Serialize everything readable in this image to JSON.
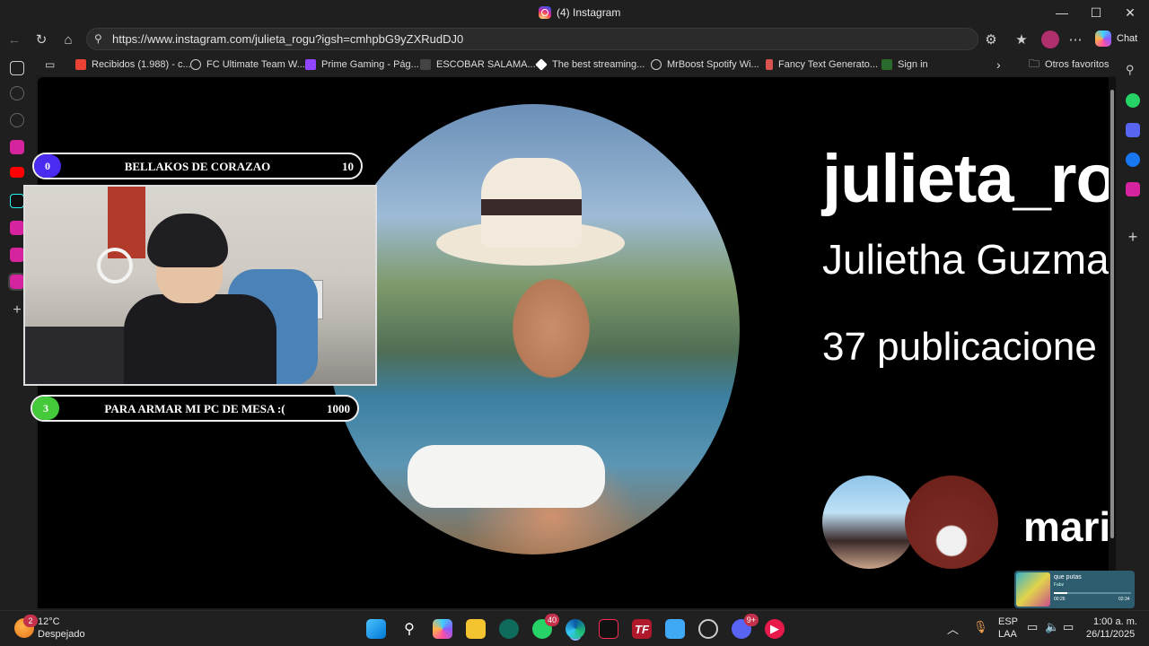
{
  "window": {
    "title": "(4) Instagram",
    "controls": {
      "minimize": "—",
      "maximize": "☐",
      "close": "✕"
    }
  },
  "nav": {
    "url": "https://www.instagram.com/julieta_rogu?igsh=cmhpbG9yZXRudDJ0",
    "chat_label": "Chat"
  },
  "bookmarks": [
    {
      "label": "Recibidos (1.988) - c...",
      "icon": "gmail-icon",
      "color": "#ea4335"
    },
    {
      "label": "FC Ultimate Team W...",
      "icon": "globe-icon",
      "color": "#cfcfcf"
    },
    {
      "label": "Prime Gaming - Pág...",
      "icon": "prime-gaming-icon",
      "color": "#9146ff"
    },
    {
      "label": "ESCOBAR SALAMA...",
      "icon": "page-icon",
      "color": "#444444"
    },
    {
      "label": "The best streaming...",
      "icon": "diamond-icon",
      "color": "#ffffff"
    },
    {
      "label": "MrBoost Spotify Wi...",
      "icon": "globe-icon",
      "color": "#cfcfcf"
    },
    {
      "label": "Fancy Text Generato...",
      "icon": "page-icon",
      "color": "#d9534f"
    },
    {
      "label": "Sign in",
      "icon": "bat-icon",
      "color": "#2b6b2b"
    }
  ],
  "other_favorites": "Otros favoritos",
  "profile": {
    "username": "julieta_ro",
    "full_name": "Julietha Guzma",
    "posts": "37 publicacione",
    "follower_handle": "mari"
  },
  "overlays": {
    "goal_top": {
      "count": "0",
      "title": "BELLAKOS DE CORAZAO",
      "target": "10",
      "color": "#4a2cf0"
    },
    "goal_bottom": {
      "count": "3",
      "title": "PARA ARMAR MI PC DE MESA :(",
      "target": "1000",
      "color": "#43c93a"
    }
  },
  "music": {
    "title": "que putas",
    "artist": "Fabz",
    "elapsed": "00:26",
    "duration": "02:34",
    "progress": 0.17
  },
  "taskbar": {
    "weather": {
      "temp": "12°C",
      "condition": "Despejado",
      "badge": "2"
    },
    "whatsapp_badge": "40",
    "discord_badge": "9+",
    "lang": "ESP",
    "layout": "LAA",
    "time": "1:00 a. m.",
    "date": "26/11/2025"
  }
}
